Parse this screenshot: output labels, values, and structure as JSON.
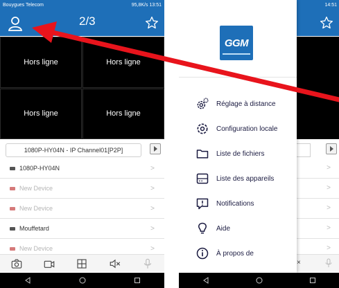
{
  "left_phone": {
    "status": {
      "carrier": "Bouygues Telecom",
      "right": "95,8K/s",
      "time": "13:51"
    },
    "header": {
      "page_counter": "2/3"
    },
    "video_cells": [
      "Hors ligne",
      "Hors ligne",
      "Hors ligne",
      "Hors ligne"
    ],
    "channel": {
      "label": "1080P-HY04N - IP Channel01[P2P]"
    },
    "devices": [
      {
        "name": "1080P-HY04N",
        "online": true
      },
      {
        "name": "New Device",
        "online": false
      },
      {
        "name": "New Device",
        "online": false
      },
      {
        "name": "Mouffetard",
        "online": true
      },
      {
        "name": "New Device",
        "online": false
      }
    ]
  },
  "right_phone": {
    "status": {
      "time": "14:51"
    },
    "logo_text": "GGM",
    "menu": [
      {
        "label": "Réglage à distance",
        "icon": "gear-double-icon"
      },
      {
        "label": "Configuration locale",
        "icon": "gear-icon"
      },
      {
        "label": "Liste de fichiers",
        "icon": "folder-icon"
      },
      {
        "label": "Liste des appareils",
        "icon": "device-icon"
      },
      {
        "label": "Notifications",
        "icon": "notification-icon"
      },
      {
        "label": "Aide",
        "icon": "lightbulb-icon"
      },
      {
        "label": "À propos de",
        "icon": "info-icon"
      }
    ]
  },
  "colors": {
    "brand_blue": "#1e6fb8",
    "arrow_red": "#e8141c",
    "offline_gray": "#b5b5b5"
  }
}
